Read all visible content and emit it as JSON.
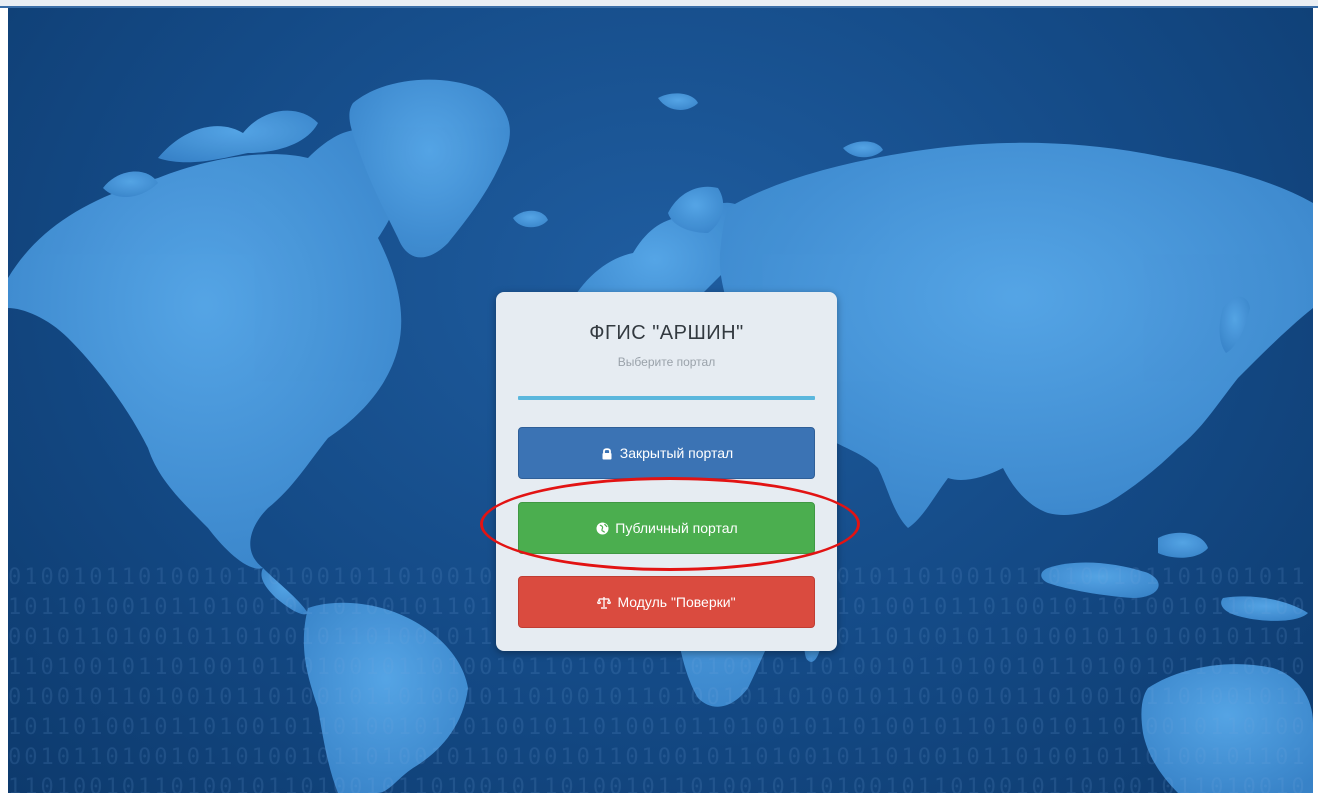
{
  "card": {
    "title": "ФГИС \"АРШИН\"",
    "subtitle": "Выберите портал"
  },
  "buttons": {
    "closed_portal": {
      "label": "Закрытый портал",
      "icon": "lock-icon",
      "color": "#3b73b4"
    },
    "public_portal": {
      "label": "Публичный портал",
      "icon": "globe-icon",
      "color": "#4bae4f"
    },
    "verification_module": {
      "label": "Модуль \"Поверки\"",
      "icon": "balance-scale-icon",
      "color": "#da4b3f"
    }
  },
  "colors": {
    "background_map": "#144a86",
    "land": "#3f8fd6",
    "accent_rule": "#5bb7dd",
    "annotation": "#e21313"
  }
}
